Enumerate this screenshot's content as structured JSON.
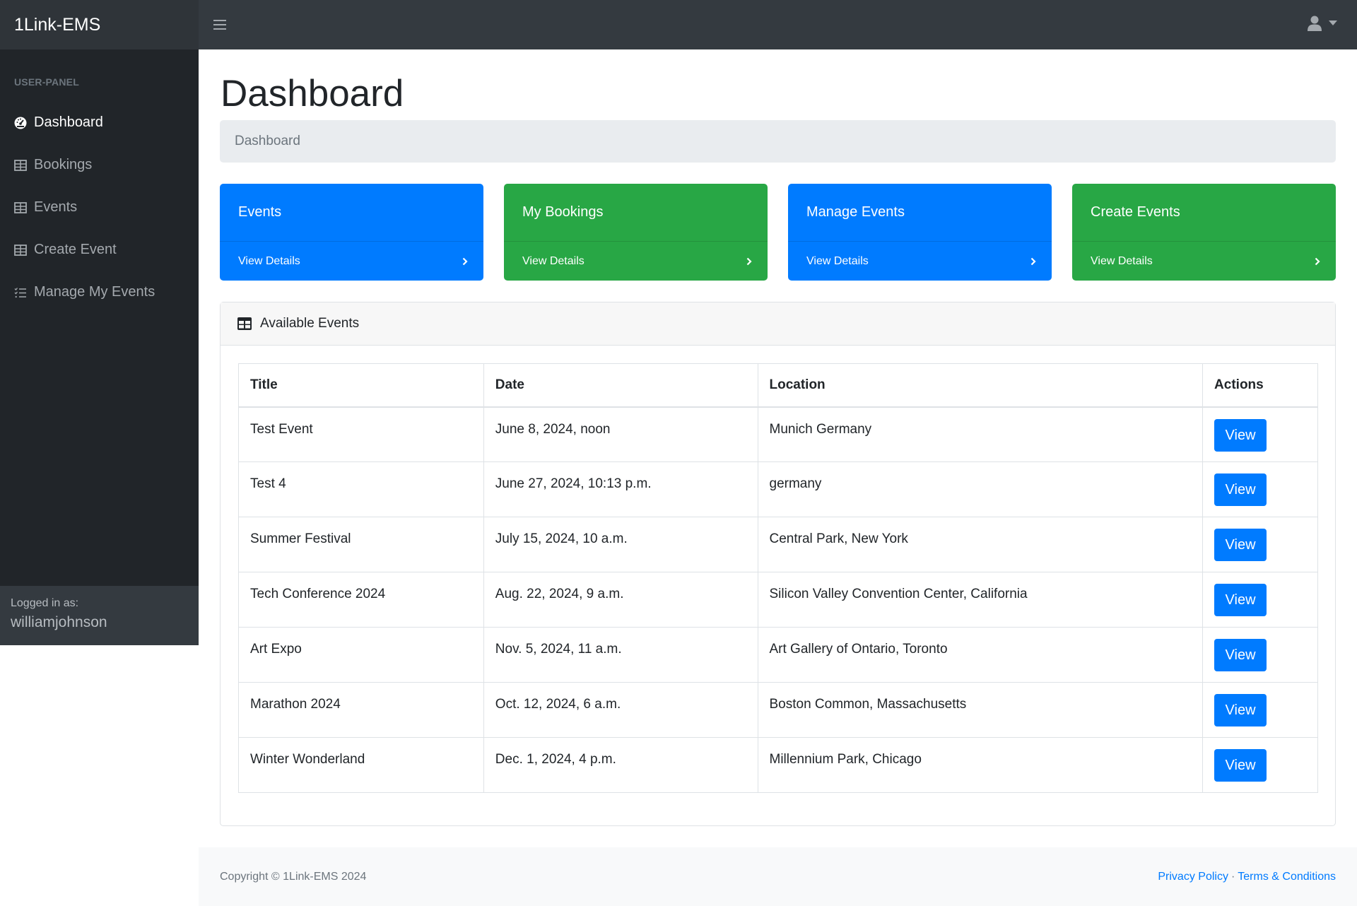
{
  "app": {
    "brand": "1Link-EMS"
  },
  "sidebar": {
    "heading": "USER-PANEL",
    "items": [
      {
        "label": "Dashboard",
        "icon": "dashboard-icon",
        "active": true
      },
      {
        "label": "Bookings",
        "icon": "table-icon"
      },
      {
        "label": "Events",
        "icon": "table-icon"
      },
      {
        "label": "Create Event",
        "icon": "table-icon"
      },
      {
        "label": "Manage My Events",
        "icon": "list-icon"
      }
    ],
    "footer": {
      "logged_in_label": "Logged in as:",
      "username": "williamjohnson"
    }
  },
  "main": {
    "title": "Dashboard",
    "breadcrumb": "Dashboard",
    "cards": [
      {
        "title": "Events",
        "link": "View Details",
        "color": "#007bff"
      },
      {
        "title": "My Bookings",
        "link": "View Details",
        "color": "#28a745"
      },
      {
        "title": "Manage Events",
        "link": "View Details",
        "color": "#007bff"
      },
      {
        "title": "Create Events",
        "link": "View Details",
        "color": "#28a745"
      }
    ],
    "panel": {
      "title": "Available Events",
      "columns": [
        "Title",
        "Date",
        "Location",
        "Actions"
      ],
      "rows": [
        {
          "title": "Test Event",
          "date": "June 8, 2024, noon",
          "location": "Munich Germany",
          "action": "View"
        },
        {
          "title": "Test 4",
          "date": "June 27, 2024, 10:13 p.m.",
          "location": "germany",
          "action": "View"
        },
        {
          "title": "Summer Festival",
          "date": "July 15, 2024, 10 a.m.",
          "location": "Central Park, New York",
          "action": "View"
        },
        {
          "title": "Tech Conference 2024",
          "date": "Aug. 22, 2024, 9 a.m.",
          "location": "Silicon Valley Convention Center, California",
          "action": "View"
        },
        {
          "title": "Art Expo",
          "date": "Nov. 5, 2024, 11 a.m.",
          "location": "Art Gallery of Ontario, Toronto",
          "action": "View"
        },
        {
          "title": "Marathon 2024",
          "date": "Oct. 12, 2024, 6 a.m.",
          "location": "Boston Common, Massachusetts",
          "action": "View"
        },
        {
          "title": "Winter Wonderland",
          "date": "Dec. 1, 2024, 4 p.m.",
          "location": "Millennium Park, Chicago",
          "action": "View"
        }
      ]
    }
  },
  "footer": {
    "copyright": "Copyright © 1Link-EMS 2024",
    "privacy": "Privacy Policy",
    "separator": "·",
    "terms": "Terms & Conditions"
  }
}
